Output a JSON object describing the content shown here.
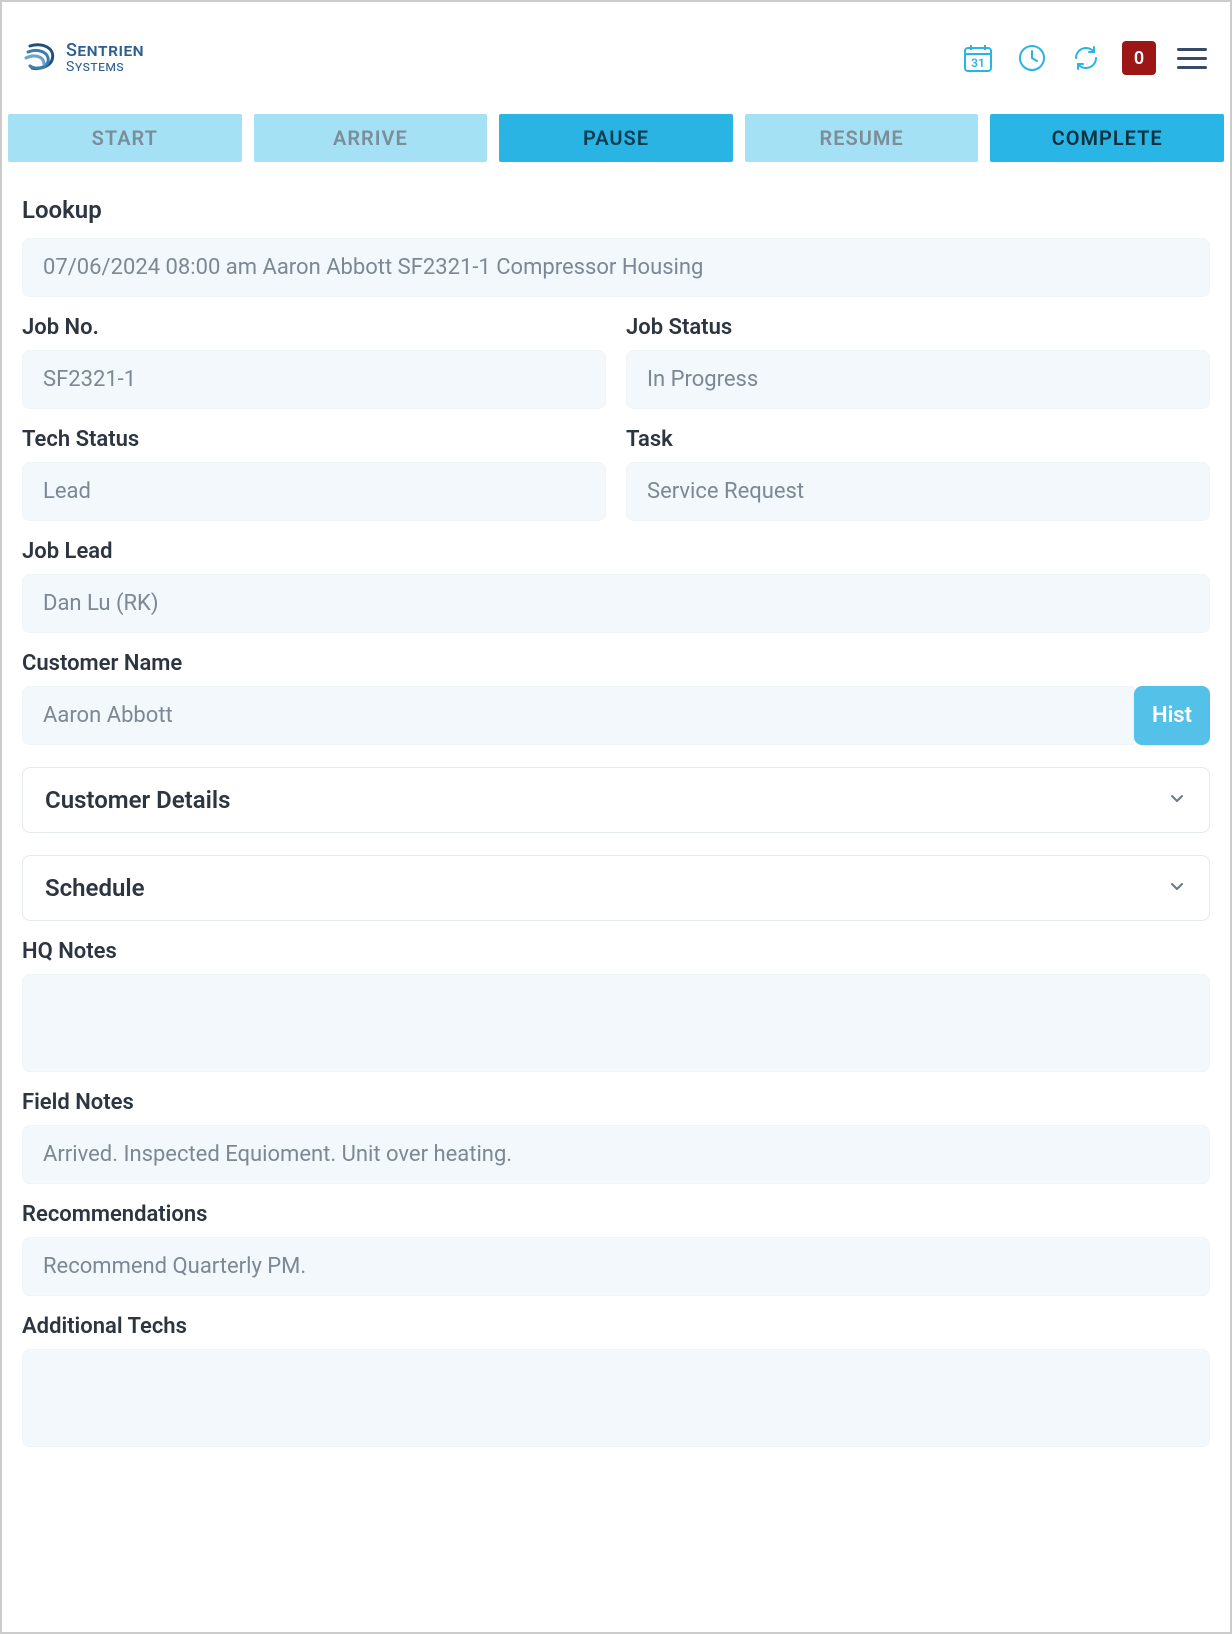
{
  "header": {
    "logo_top": "Sentrien",
    "logo_bottom": "Systems",
    "calendar_day": "31",
    "badge_count": "0"
  },
  "tabs": {
    "start": "START",
    "arrive": "ARRIVE",
    "pause": "PAUSE",
    "resume": "RESUME",
    "complete": "COMPLETE"
  },
  "form": {
    "lookup_label": "Lookup",
    "lookup_value": "07/06/2024 08:00 am Aaron Abbott SF2321-1 Compressor Housing",
    "job_no_label": "Job No.",
    "job_no_value": "SF2321-1",
    "job_status_label": "Job Status",
    "job_status_value": "In Progress",
    "tech_status_label": "Tech Status",
    "tech_status_value": "Lead",
    "task_label": "Task",
    "task_value": "Service Request",
    "job_lead_label": "Job Lead",
    "job_lead_value": "Dan Lu (RK)",
    "customer_name_label": "Customer Name",
    "customer_name_value": "Aaron Abbott",
    "hist_button": "Hist",
    "customer_details_header": "Customer Details",
    "schedule_header": "Schedule",
    "hq_notes_label": "HQ Notes",
    "hq_notes_value": "",
    "field_notes_label": "Field Notes",
    "field_notes_value": "Arrived. Inspected Equioment. Unit over heating.",
    "recommendations_label": "Recommendations",
    "recommendations_value": "Recommend Quarterly PM.",
    "additional_techs_label": "Additional Techs",
    "additional_techs_value": ""
  }
}
